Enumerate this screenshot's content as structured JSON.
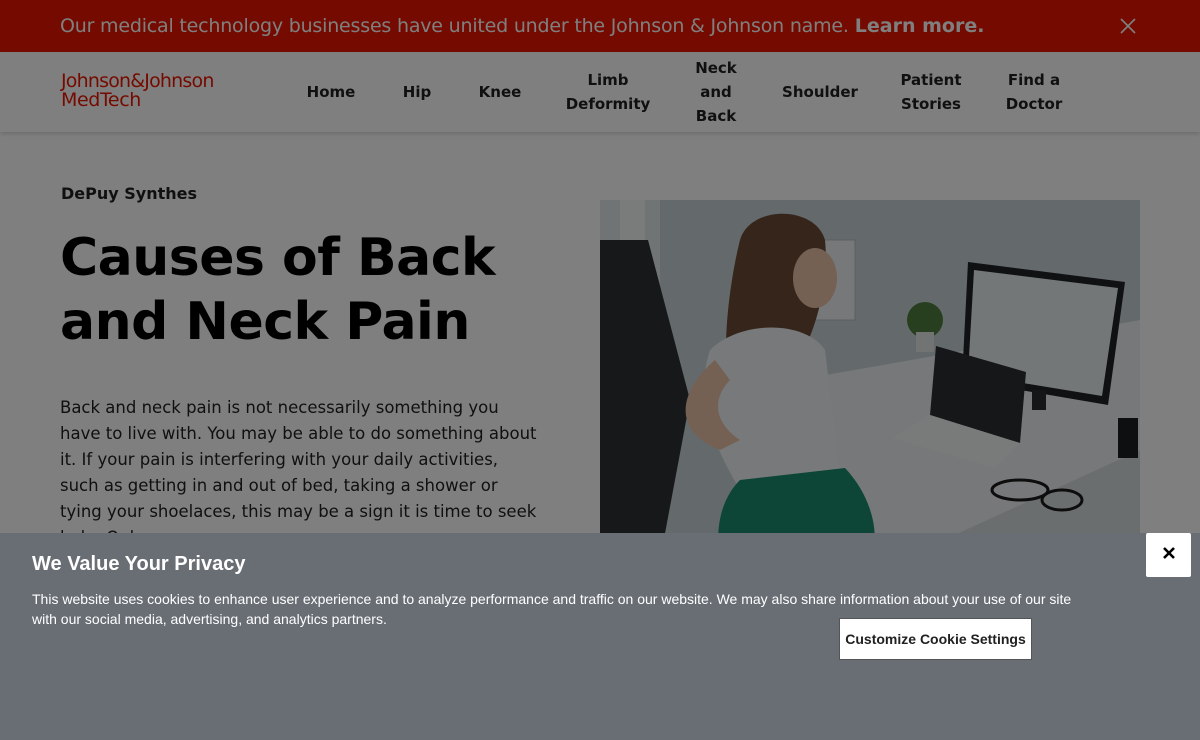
{
  "banner": {
    "text": "Our medical technology businesses have united under the Johnson & Johnson name.",
    "link": "Learn more.",
    "close_icon": "close-icon"
  },
  "logo": {
    "line1": "Johnson&Johnson",
    "line2": "MedTech"
  },
  "nav": {
    "items": [
      {
        "lines": [
          "Home"
        ]
      },
      {
        "lines": [
          "Hip"
        ]
      },
      {
        "lines": [
          "Knee"
        ]
      },
      {
        "lines": [
          "Limb",
          "Deformity"
        ]
      },
      {
        "lines": [
          "Neck",
          "and",
          "Back"
        ]
      },
      {
        "lines": [
          "Shoulder"
        ]
      },
      {
        "lines": [
          "Patient",
          "Stories"
        ]
      },
      {
        "lines": [
          "Find a",
          "Doctor"
        ]
      }
    ]
  },
  "main": {
    "subtitle": "DePuy Synthes",
    "title": "Causes of Back and Neck Pain",
    "body": "Back and neck pain is not necessarily something you have to live with. You may be able to do something about it. If your pain is interfering with your daily activities, such as getting in and out of bed, taking a shower or tying your shoelaces, this may be a sign it is time to seek help. Only"
  },
  "cookie": {
    "title": "We Value Your Privacy",
    "text": "This website uses cookies to enhance user experience and to analyze performance and traffic on our website. We may also share information about your use of our site with our social media, advertising, and analytics partners.",
    "settings_label": "Customize Cookie Settings",
    "close_icon": "close-icon"
  },
  "colors": {
    "brand_red": "#eb1700",
    "cookie_bg": "#696e75"
  }
}
